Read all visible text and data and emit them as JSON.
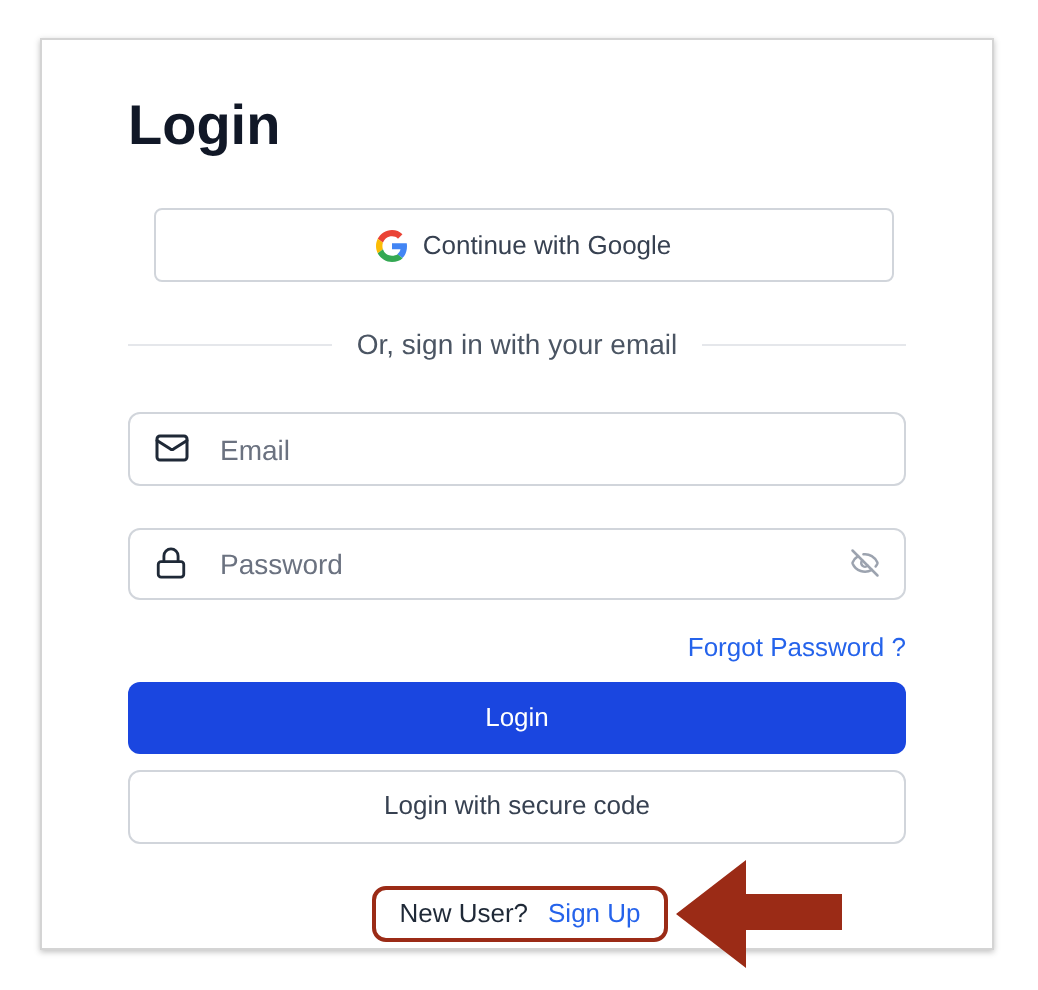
{
  "title": "Login",
  "google_button": {
    "label": "Continue with Google"
  },
  "divider_text": "Or, sign in with your email",
  "email_field": {
    "placeholder": "Email"
  },
  "password_field": {
    "placeholder": "Password"
  },
  "forgot_link": "Forgot Password ?",
  "login_button": "Login",
  "secure_code_button": "Login with secure code",
  "signup_prompt": {
    "text": "New User?",
    "link": "Sign Up"
  }
}
